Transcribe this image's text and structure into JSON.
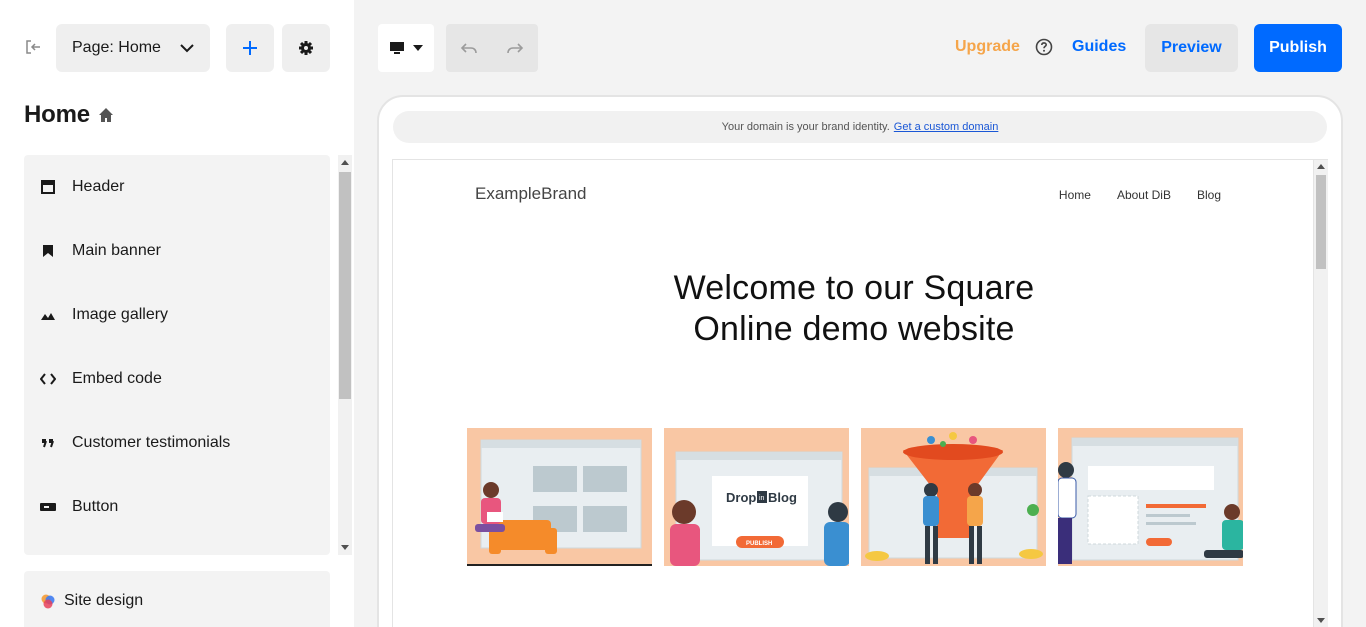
{
  "sidebar": {
    "page_select_label": "Page: Home",
    "page_title": "Home",
    "sections": [
      {
        "label": "Header",
        "icon": "header-icon"
      },
      {
        "label": "Main banner",
        "icon": "bookmark-icon"
      },
      {
        "label": "Image gallery",
        "icon": "image-icon"
      },
      {
        "label": "Embed code",
        "icon": "code-icon"
      },
      {
        "label": "Customer testimonials",
        "icon": "quote-icon"
      },
      {
        "label": "Button",
        "icon": "button-icon"
      }
    ],
    "site_design_label": "Site design"
  },
  "toolbar": {
    "upgrade_label": "Upgrade",
    "guides_label": "Guides",
    "preview_label": "Preview",
    "publish_label": "Publish"
  },
  "preview": {
    "domain_notice": "Your domain is your brand identity.",
    "domain_link": "Get a custom domain",
    "brand": "ExampleBrand",
    "nav": [
      "Home",
      "About DiB",
      "Blog"
    ],
    "hero_line1": "Welcome to our Square",
    "hero_line2": "Online demo website",
    "gallery_logo_text": "Drop",
    "gallery_logo_mid": "in",
    "gallery_logo_end": "Blog",
    "gallery_button_text": "PUBLISH"
  },
  "colors": {
    "accent": "#006aff",
    "upgrade": "#f5a54a",
    "tile_bg": "#f9c7a4"
  }
}
